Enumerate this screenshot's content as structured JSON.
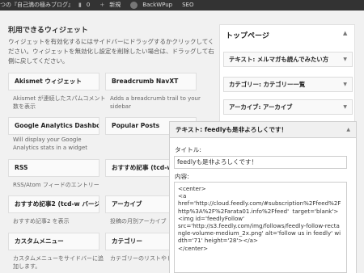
{
  "adminbar": {
    "site_name": "つの『自己満の極みブログ』",
    "comments_count": "0",
    "new_label": "新規",
    "plugin_label": "BackWPup",
    "seo_label": "SEO"
  },
  "widgets": {
    "title": "利用できるウィジェット",
    "description": "ウィジェットを有効化するにはサイドバーにドラッグするかクリックしてください。ウィジェットを無効化し設定を削除したい場合は、ドラッグして右側に戻してください。",
    "items": [
      {
        "label": "Akismet ウィジェット",
        "desc": "Akismet が連続したスパムコメント数を表示"
      },
      {
        "label": "Breadcrumb NavXT",
        "desc": "Adds a breadcrumb trail to your sidebar"
      },
      {
        "label": "Google Analytics Dashboard",
        "desc": "Will display your Google Analytics stats in a widget"
      },
      {
        "label": "Popular Posts",
        "desc": ""
      },
      {
        "label": "RSS",
        "desc": "RSS/Atom フィードのエントリー"
      },
      {
        "label": "おすすめ記事 (tcd-w",
        "desc": ""
      },
      {
        "label": "おすすめ記事2 (tcd-w バージ…",
        "desc": "おすすめ記事2 を表示"
      },
      {
        "label": "アーカイブ",
        "desc": "投稿の月別アーカイブ"
      },
      {
        "label": "カスタムメニュー",
        "desc": "カスタムメニューをサイドバーに追加します。"
      },
      {
        "label": "カテゴリー",
        "desc": "カテゴリーのリストやド ウン"
      }
    ]
  },
  "sidebar": {
    "title": "トップページ",
    "items": [
      {
        "label": "テキスト: メルマガも読んでみたい方"
      },
      {
        "label": "カテゴリー: カテゴリー一覧"
      },
      {
        "label": "アーカイブ: アーカイブ"
      }
    ]
  },
  "expanded": {
    "header": "テキスト: feedlyも是非よろしくです！",
    "title_label": "タイトル:",
    "title_value": "feedlyも是非よろしくです！",
    "content_label": "内容:",
    "content_value": "<center>\n<a\nhref='http://cloud.feedly.com/#subscription%2Ffeed%2Fhttp%3A%2F%2Farata01.info%2Ffeed'  target='blank'><img id='feedlyFollow'\nsrc='http://s3.feedly.com/img/follows/feedly-follow-rectangle-volume-medium_2x.png' alt='follow us in feedly' width='71' height='28'></a>\n</center>"
  },
  "icons": {
    "comment": "comment-icon",
    "plus": "plus-icon",
    "backwpup": "backwpup-icon",
    "arrow": "triangle-down-icon"
  }
}
